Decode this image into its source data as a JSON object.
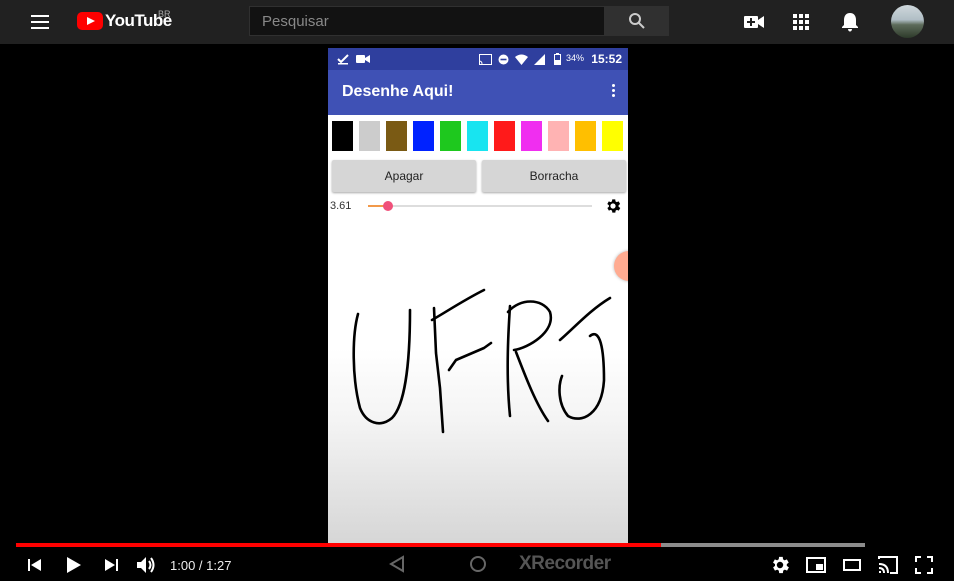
{
  "masthead": {
    "logo_text": "YouTube",
    "country": "BR",
    "search_placeholder": "Pesquisar",
    "icons": [
      "menu-icon",
      "search-icon",
      "video-camera-plus-icon",
      "apps-grid-icon",
      "bell-icon"
    ]
  },
  "app": {
    "status_time": "15:52",
    "status_battery": "34%",
    "title": "Desenhe Aqui!",
    "palette": [
      "#000000",
      "#cccccc",
      "#7a5a14",
      "#0022ff",
      "#1ec81e",
      "#18e4f0",
      "#ff1a1a",
      "#f02ef0",
      "#ffb3b3",
      "#ffbf00",
      "#ffff00"
    ],
    "erase_button": "Apagar",
    "eraser_button": "Borracha",
    "brush_size": "3.61",
    "brush_slider_fraction": 0.09
  },
  "player": {
    "time_current": "1:00",
    "time_total": "1:27",
    "time_display": "1:00 / 1:27",
    "played_fraction": 0.76,
    "loaded_fraction": 1.0,
    "watermark": "XRecorder",
    "accent_color": "#ff0000"
  }
}
